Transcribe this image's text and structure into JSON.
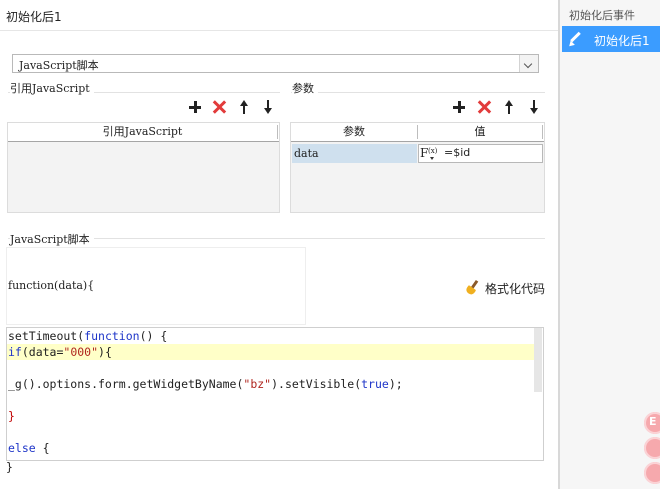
{
  "dialog": {
    "title": "初始化后1"
  },
  "script_type_select": {
    "value": "JavaScript脚本"
  },
  "ref_js_section": {
    "label": "引用JavaScript",
    "column_header": "引用JavaScript"
  },
  "params_section": {
    "label": "参数",
    "columns": [
      "参数",
      "值"
    ],
    "rows": [
      {
        "name": "data",
        "value_icon": "formula-icon",
        "value": "=$id"
      }
    ]
  },
  "script_section": {
    "label": "JavaScript脚本",
    "header_line": "function(data){",
    "format_button": "格式化代码",
    "closing_brace": "}"
  },
  "code_lines": [
    "setTimeout(function() {",
    "if(data=\"000\"){",
    "",
    "_g().options.form.getWidgetByName(\"bz\").setVisible(true);",
    "",
    "}",
    "",
    "else {"
  ],
  "sidebar": {
    "header": "初始化后事件",
    "items": [
      {
        "label": "初始化后1",
        "icon": "pencil-icon",
        "selected": true
      }
    ]
  },
  "floating_buttons": [
    "E",
    "",
    ""
  ],
  "colors": {
    "accent": "#3b9cff",
    "delete": "#e23b3b",
    "selected_row": "#cfe0ee",
    "line_highlight": "#ffffc8"
  }
}
